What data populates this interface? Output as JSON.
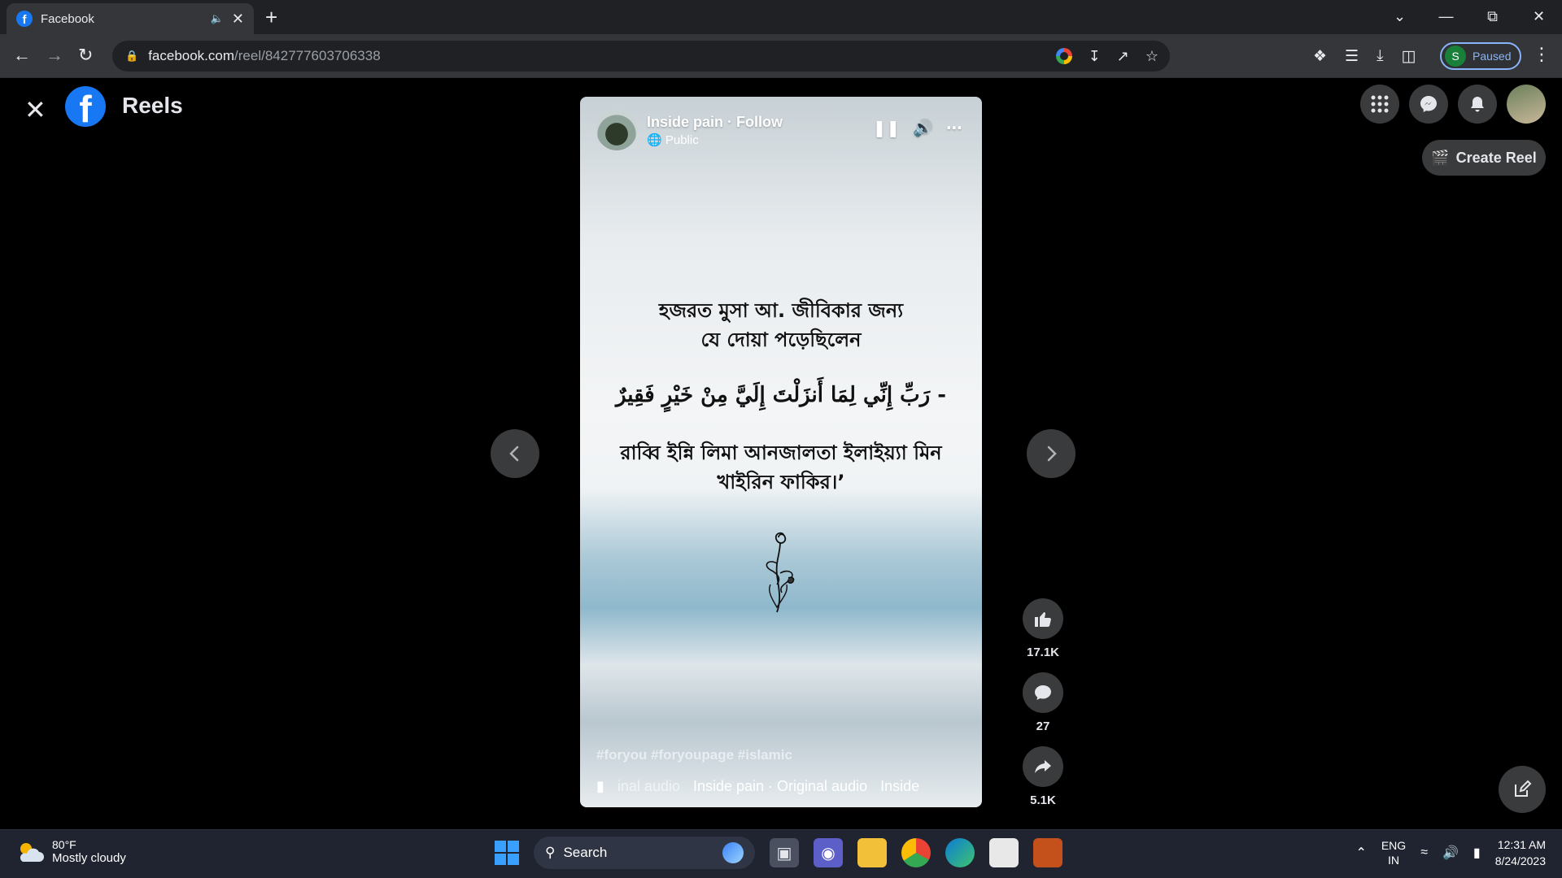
{
  "browser": {
    "tab_title": "Facebook",
    "tab_audio_icon": "speaker-icon",
    "new_tab": "+",
    "url_host": "facebook.com",
    "url_path": "/reel/842777603706338",
    "profile_initial": "S",
    "profile_status": "Paused"
  },
  "header": {
    "title": "Reels",
    "create_reel_label": "Create Reel"
  },
  "reel": {
    "author": "Inside pain · Follow",
    "visibility": "Public",
    "text_line1a": "হজরত মুসা আ. জীবিকার জন্য",
    "text_line1b": "যে দোয়া পড়েছিলেন",
    "text_arabic": "- رَبِّ إِنِّي لِمَا أَنزَلْتَ إِلَيَّ مِنْ خَيْرٍ فَقِيرٌ",
    "text_line3a": "রাব্বি ইন্নি লিমা আনজালতা ইলাইয়্যা মিন",
    "text_line3b": "খাইরিন ফাকির।’",
    "hashtags": "#foryou #foryoupage #islamic",
    "audio_fade": "inal audio",
    "audio_main": "Inside pain · Original audio",
    "audio_tail": "Inside",
    "likes": "17.1K",
    "comments": "27",
    "shares": "5.1K"
  },
  "taskbar": {
    "temperature": "80°F",
    "weather": "Mostly cloudy",
    "search_label": "Search",
    "lang_top": "ENG",
    "lang_bottom": "IN",
    "time": "12:31 AM",
    "date": "8/24/2023"
  },
  "colors": {
    "accent": "#1877f2",
    "page_bg": "#000000",
    "button_bg": "#3a3b3c",
    "taskbar_bg": "#1f2430"
  }
}
